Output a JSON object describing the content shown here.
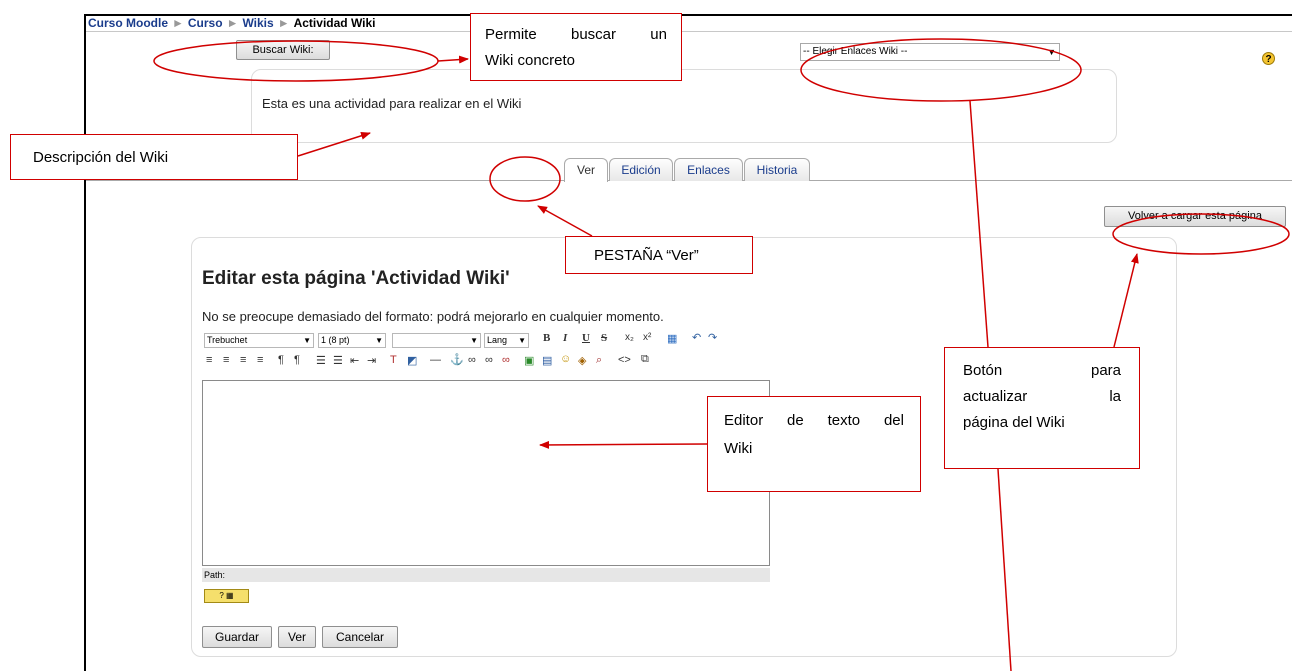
{
  "breadcrumb": {
    "items": [
      "Curso Moodle",
      "Curso",
      "Wikis",
      "Actividad Wiki"
    ],
    "separator": "►"
  },
  "header": {
    "search_button_label": "Buscar Wiki:",
    "wiki_links_select": "-- Elegir Enlaces Wiki --",
    "help_icon": "?"
  },
  "description": {
    "text": "Esta es una actividad para realizar en el Wiki"
  },
  "tabs": [
    {
      "label": "Ver",
      "active": true
    },
    {
      "label": "Edición",
      "active": false
    },
    {
      "label": "Enlaces",
      "active": false
    },
    {
      "label": "Historia",
      "active": false
    }
  ],
  "reload_button_label": "Volver a cargar esta página",
  "editor": {
    "title": "Editar esta página 'Actividad Wiki'",
    "hint": "No se preocupe demasiado del formato: podrá mejorarlo en cualquier momento.",
    "font_family": "Trebuchet",
    "font_size": "1 (8 pt)",
    "style_select": "",
    "lang_select": "Lang",
    "path_label": "Path:",
    "buttons": {
      "save": "Guardar",
      "view": "Ver",
      "cancel": "Cancelar"
    }
  },
  "annotations": {
    "search": [
      "Permite buscar un",
      "Wiki concreto"
    ],
    "description": "Descripción del Wiki",
    "tab": "PESTAÑA “Ver”",
    "editor": [
      "Editor de texto del",
      "Wiki"
    ],
    "reload": [
      "Botón para",
      "actualizar la",
      "página del Wiki"
    ]
  },
  "colors": {
    "annotation": "#d00000",
    "link": "#1a3c8c"
  }
}
